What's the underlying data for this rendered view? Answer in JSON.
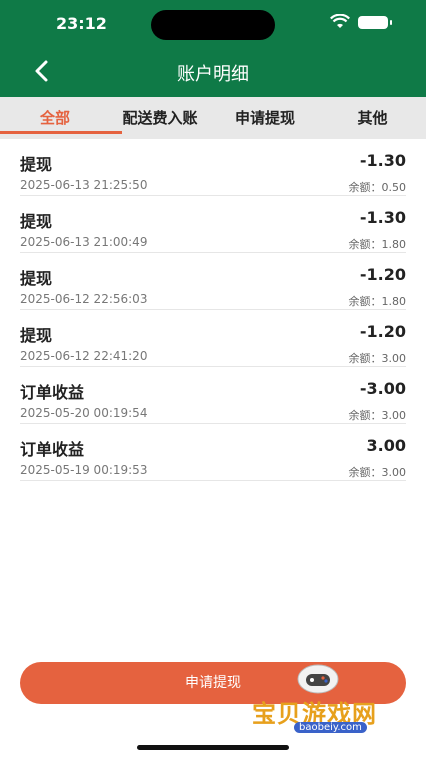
{
  "status_bar": {
    "time": "23:12"
  },
  "header": {
    "title": "账户明细"
  },
  "tabs": [
    {
      "label": "全部",
      "active": true
    },
    {
      "label": "配送费入账",
      "active": false
    },
    {
      "label": "申请提现",
      "active": false
    },
    {
      "label": "其他",
      "active": false
    }
  ],
  "records": [
    {
      "type": "提现",
      "time": "2025-06-13 21:25:50",
      "amount": "-1.30",
      "balance": "余额：0.50"
    },
    {
      "type": "提现",
      "time": "2025-06-13 21:00:49",
      "amount": "-1.30",
      "balance": "余额：1.80"
    },
    {
      "type": "提现",
      "time": "2025-06-12 22:56:03",
      "amount": "-1.20",
      "balance": "余额：1.80"
    },
    {
      "type": "提现",
      "time": "2025-06-12 22:41:20",
      "amount": "-1.20",
      "balance": "余额：3.00"
    },
    {
      "type": "订单收益",
      "time": "2025-05-20 00:19:54",
      "amount": "-3.00",
      "balance": "余额：3.00"
    },
    {
      "type": "订单收益",
      "time": "2025-05-19 00:19:53",
      "amount": "3.00",
      "balance": "余额：3.00"
    }
  ],
  "footer": {
    "button_label": "申请提现"
  },
  "watermark": {
    "text": "宝贝游戏网",
    "url": "baobeiy.com"
  },
  "colors": {
    "header": "#0f7a47",
    "accent": "#e5623f"
  }
}
